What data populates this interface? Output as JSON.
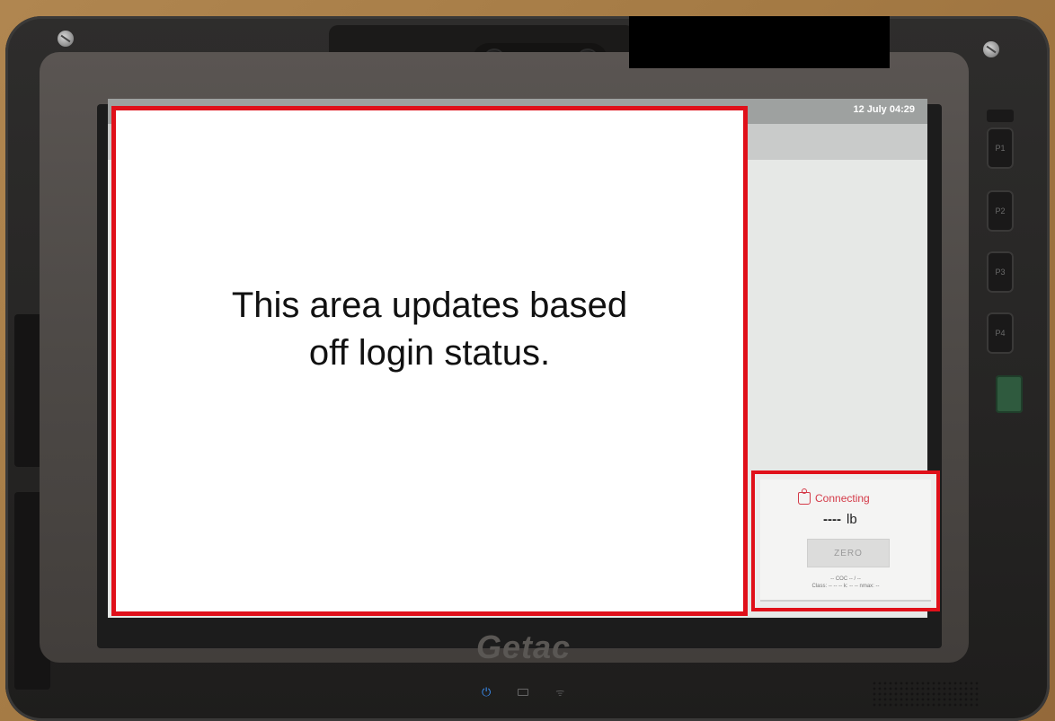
{
  "status_bar": {
    "datetime": "12 July  04:29"
  },
  "overlay": {
    "message_line1": "This area updates based",
    "message_line2": "off login status."
  },
  "scale_panel": {
    "status": "Connecting",
    "weight_value": "----",
    "weight_unit": "lb",
    "zero_label": "ZERO",
    "coc_line": "-- COC -- / --",
    "class_line": "Class: -- -- --  k: -- --  nmax: --"
  },
  "hardware": {
    "brand": "Getac",
    "side_buttons": [
      "P1",
      "P2",
      "P3",
      "P4"
    ]
  },
  "colors": {
    "highlight_red": "#e0101a",
    "status_red": "#d43a48",
    "power_blue": "#3a8df0"
  }
}
